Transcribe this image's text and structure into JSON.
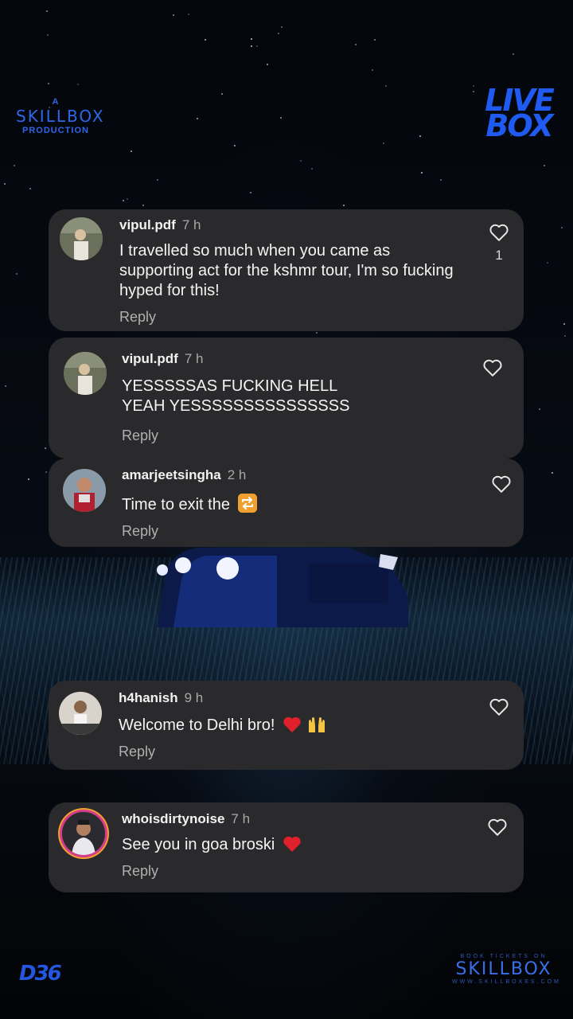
{
  "branding": {
    "top_left_a": "A",
    "top_left_name": "SKILLBOX",
    "top_left_sub": "PRODUCTION",
    "top_right_line1": "LIVE",
    "top_right_line2": "BOX",
    "bottom_left": "D36",
    "bottom_right_top": "BOOK TICKETS ON",
    "bottom_right_name": "SKILLBOX",
    "bottom_right_url": "WWW.SKILLBOXES.COM",
    "accent_color": "#2f66e8"
  },
  "comments": [
    {
      "username": "vipul.pdf",
      "time": "7 h",
      "text": "I travelled so much when you came as supporting act for the kshmr tour, I'm so fucking hyped for this!",
      "reply_label": "Reply",
      "likes": "1"
    },
    {
      "username": "vipul.pdf",
      "time": "7 h",
      "text": "YESSSSSAS FUCKING HELL YEAH YESSSSSSSSSSSSSSS",
      "reply_label": "Reply"
    },
    {
      "username": "amarjeetsingha",
      "time": "2 h",
      "text": "Time to exit the",
      "emoji": "repeat-emoji",
      "reply_label": "Reply"
    },
    {
      "username": "h4hanish",
      "time": "9 h",
      "text": "Welcome to Delhi bro!",
      "emoji": "heart-and-raised-hands-emoji",
      "reply_label": "Reply"
    },
    {
      "username": "whoisdirtynoise",
      "time": "7 h",
      "text": "See you in goa broski",
      "emoji": "heart-emoji",
      "reply_label": "Reply"
    }
  ]
}
